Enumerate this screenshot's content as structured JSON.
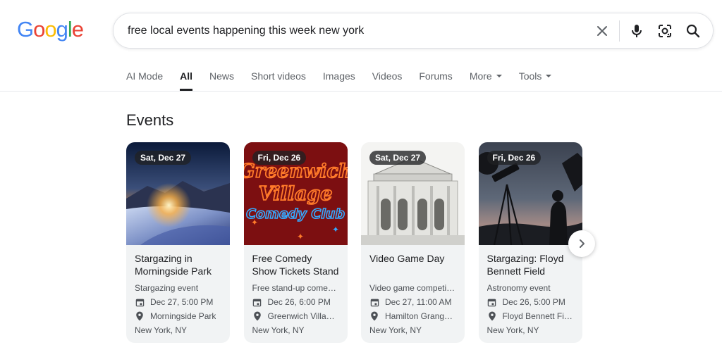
{
  "logo": {
    "letters": [
      "G",
      "o",
      "o",
      "g",
      "l",
      "e"
    ],
    "colors": [
      "#4285F4",
      "#EA4335",
      "#FBBC05",
      "#4285F4",
      "#34A853",
      "#EA4335"
    ]
  },
  "search": {
    "query": "free local events happening this week new york",
    "icons": [
      "close-icon",
      "microphone-icon",
      "lens-icon",
      "search-icon"
    ]
  },
  "tabs": [
    {
      "label": "AI Mode",
      "active": false
    },
    {
      "label": "All",
      "active": true
    },
    {
      "label": "News",
      "active": false
    },
    {
      "label": "Short videos",
      "active": false
    },
    {
      "label": "Images",
      "active": false
    },
    {
      "label": "Videos",
      "active": false
    },
    {
      "label": "Forums",
      "active": false
    },
    {
      "label": "More",
      "active": false,
      "dropdown": true
    },
    {
      "label": "Tools",
      "active": false,
      "dropdown": true
    }
  ],
  "events": {
    "title": "Events",
    "cards": [
      {
        "date": "Sat, Dec 27",
        "title": "Stargazing in Morningside Park",
        "type": "Stargazing event",
        "time": "Dec 27, 5:00 PM",
        "venue": "Morningside Park",
        "city": "New York, NY"
      },
      {
        "date": "Fri, Dec 26",
        "title": "Free Comedy Show Tickets Stand Up…",
        "type": "Free stand-up come…",
        "time": "Dec 26, 6:00 PM",
        "venue": "Greenwich Villa…",
        "city": "New York, NY",
        "image_text": [
          "Greenwich",
          "Village",
          "Comedy Club"
        ]
      },
      {
        "date": "Sat, Dec 27",
        "title": "Video Game Day",
        "type": "Video game competi…",
        "time": "Dec 27, 11:00 AM",
        "venue": "Hamilton Grang…",
        "city": "New York, NY"
      },
      {
        "date": "Fri, Dec 26",
        "title": "Stargazing: Floyd Bennett Field",
        "type": "Astronomy event",
        "time": "Dec 26, 5:00 PM",
        "venue": "Floyd Bennett Fi…",
        "city": "New York, NY"
      }
    ]
  },
  "colors": {
    "tab_text": "#5f6368",
    "tab_active": "#202124",
    "card_bg": "#f1f3f4",
    "meta_text": "#4d5156"
  }
}
